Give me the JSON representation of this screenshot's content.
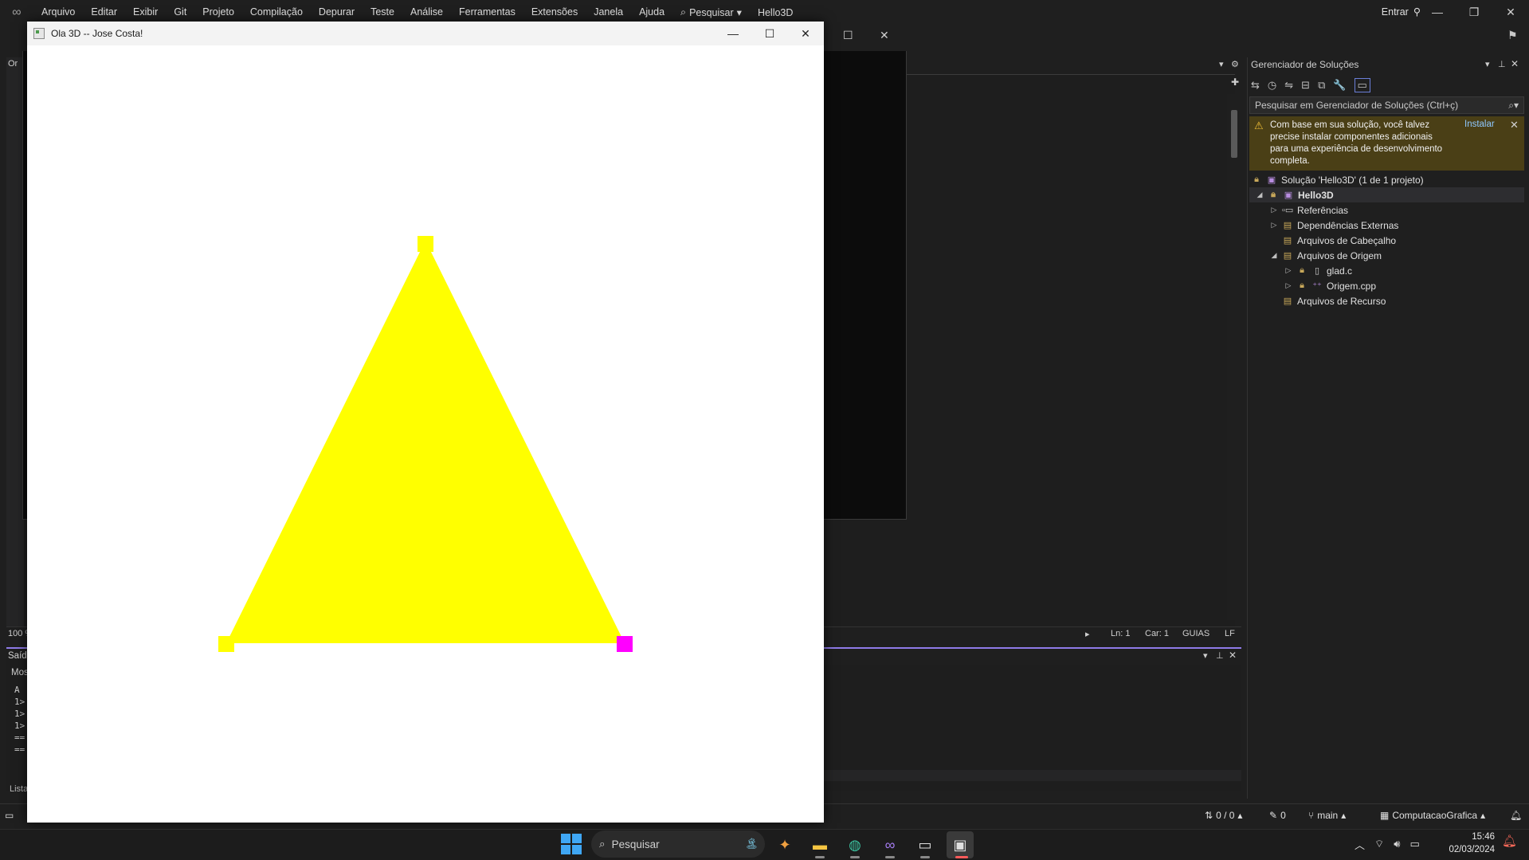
{
  "vs": {
    "menu": [
      "Arquivo",
      "Editar",
      "Exibir",
      "Git",
      "Projeto",
      "Compilação",
      "Depurar",
      "Teste",
      "Análise",
      "Ferramentas",
      "Extensões",
      "Janela",
      "Ajuda"
    ],
    "search_label": "Pesquisar",
    "solution_name": "Hello3D",
    "signin": "Entrar",
    "left_tab": "Or",
    "zoom_partial": "100 %",
    "editor_status": {
      "ln": "Ln: 1",
      "car": "Car: 1",
      "guias": "GUIAS",
      "lf": "LF"
    },
    "output": {
      "title_partial": "Saíd",
      "show_partial": "Mos",
      "lines": [
        "A",
        "1>",
        "1>",
        "1>",
        "==",
        "=="
      ],
      "list_partial": "Lista"
    },
    "statusbar": {
      "changes": "0 / 0",
      "edits": "0",
      "branch": "main",
      "repo": "ComputacaoGrafica"
    }
  },
  "solution_explorer": {
    "title": "Gerenciador de Soluções",
    "search_placeholder": "Pesquisar em Gerenciador de Soluções (Ctrl+ç)",
    "warning_text": "Com base em sua solução, você talvez precise instalar componentes adicionais para uma experiência de desenvolvimento completa.",
    "warning_action": "Instalar",
    "tree": {
      "solution": "Solução 'Hello3D' (1 de 1 projeto)",
      "project": "Hello3D",
      "references": "Referências",
      "external_deps": "Dependências Externas",
      "header_files": "Arquivos de Cabeçalho",
      "source_files": "Arquivos de Origem",
      "glad": "glad.c",
      "origem": "Origem.cpp",
      "resource_files": "Arquivos de Recurso"
    }
  },
  "gl_window": {
    "title": "Ola 3D -- Jose Costa!",
    "background": "#ffffff",
    "triangle_color": "#ffff00",
    "vertex_colors": [
      "#ffff00",
      "#ffff00",
      "#ff00ff"
    ]
  },
  "taskbar": {
    "search": "Pesquisar",
    "time": "15:46",
    "date": "02/03/2024"
  }
}
